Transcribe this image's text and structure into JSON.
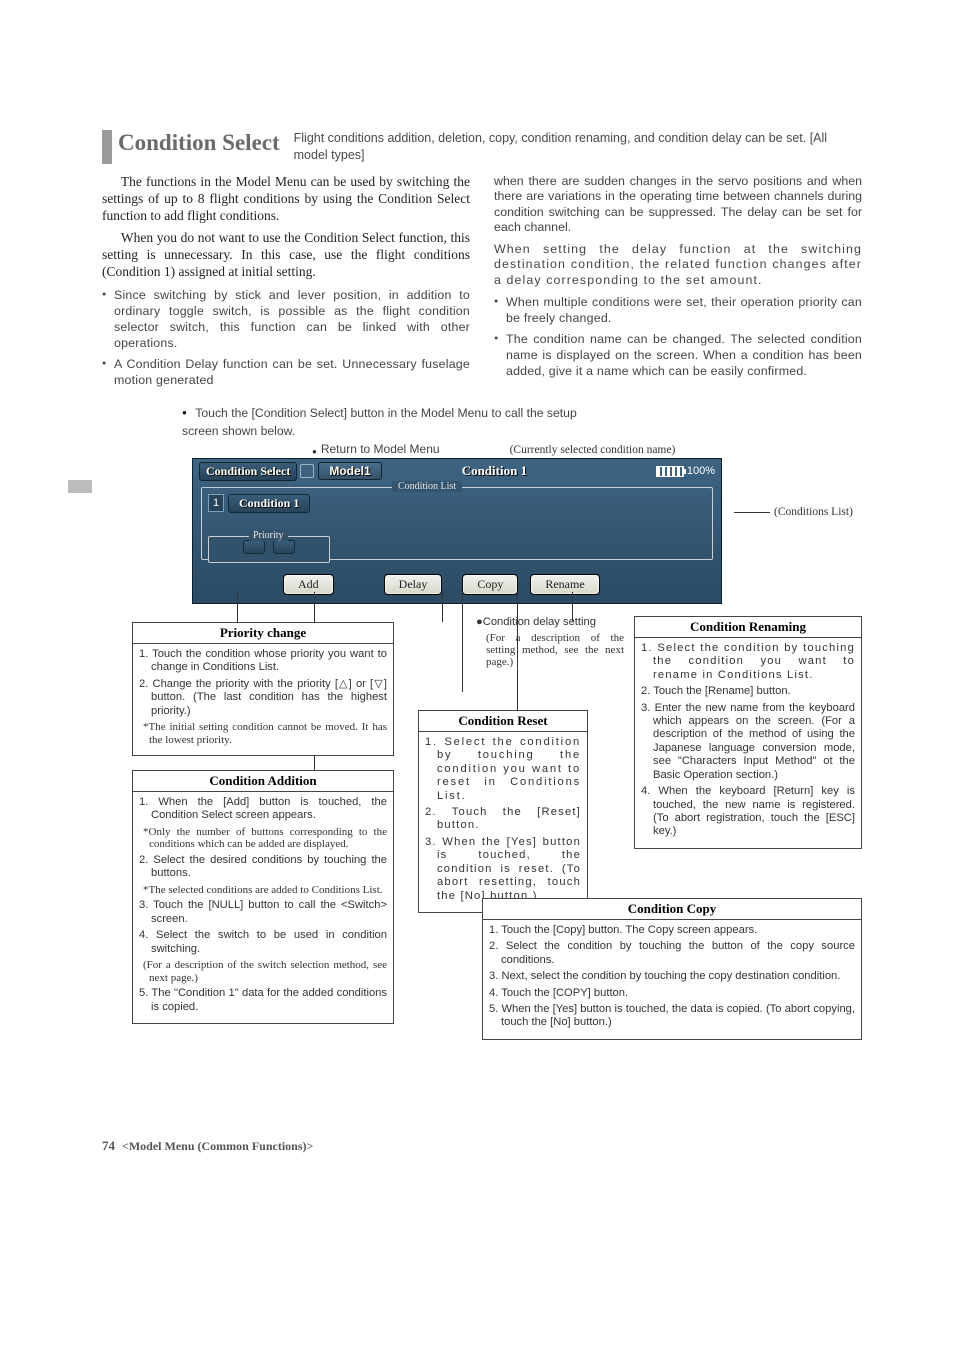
{
  "header": {
    "title": "Condition Select",
    "subtitle": "Flight conditions addition, deletion, copy, condition renaming, and condition delay can be set. [All model types]"
  },
  "intro": {
    "p1": "The functions in the Model Menu can be used by switching the settings of up to 8 flight conditions by using the Condition Select function to add flight conditions.",
    "p2": "When you do not want to use the Condition Select function, this setting is unnecessary. In this case, use the flight conditions (Condition 1) assigned at initial setting."
  },
  "left_bullets": [
    "Since switching by stick and lever position, in addition to ordinary toggle switch, is possible as the flight condition selector switch, this function can be linked with other operations.",
    "A Condition Delay function can be set. Unnecessary fuselage motion generated"
  ],
  "right_continuation": "when there are sudden changes in the servo positions and when there are variations in the operating time between channels during condition switching can be suppressed. The delay can be set for each channel.",
  "right_continuation2": "When setting the delay function at the switching destination condition, the related function changes after a delay corresponding to the set amount.",
  "right_bullets": [
    "When multiple conditions were set, their operation priority can be freely changed.",
    "The condition name can be changed. The selected condition name is displayed on the screen. When a condition has been added, give it a name which can be easily confirmed."
  ],
  "touch_note": "Touch the [Condition Select] button in the Model Menu to call the setup screen shown below.",
  "callouts": {
    "return": "Return to Model Menu",
    "current": "(Currently selected condition name)",
    "conditions_list": "(Conditions List)"
  },
  "screen": {
    "title_btn": "Condition Select",
    "model": "Model1",
    "current_condition": "Condition 1",
    "battery": "100%",
    "list_label": "Condition List",
    "row_num": "1",
    "row_name": "Condition 1",
    "priority_label": "Priority",
    "btn_add": "Add",
    "btn_delay": "Delay",
    "btn_copy": "Copy",
    "btn_rename": "Rename"
  },
  "delay_note": {
    "head": "●Condition delay setting",
    "sub": "(For a description of the setting method, see the next page.)"
  },
  "box_priority": {
    "title": "Priority change",
    "items": [
      "1. Touch the condition whose priority you want to change in Conditions List.",
      "2. Change the priority with the priority [△] or [▽] button. (The last condition has the highest priority.)"
    ],
    "note": "*The initial setting condition cannot be moved. It has the lowest priority."
  },
  "box_addition": {
    "title": "Condition Addition",
    "items": [
      "1. When the [Add] button is touched, the Condition Select screen appears.",
      "__note1",
      "2. Select the desired conditions by touching the buttons.",
      "__note2",
      "3. Touch the [NULL] button to call the <Switch> screen.",
      "4. Select the switch to be used in condition switching.",
      "__note3",
      "5. The \"Condition 1\" data for the added conditions is copied."
    ],
    "note1": "*Only the number of buttons corresponding to the conditions which can be added are displayed.",
    "note2": "*The selected conditions are added to Conditions List.",
    "note3": "(For a description of the switch selection method, see next page.)"
  },
  "box_reset": {
    "title": "Condition Reset",
    "items": [
      "1. Select the condition by touching the condition you want to reset in Conditions List.",
      "2. Touch the [Reset] button.",
      "3. When the [Yes] button is touched, the condition is reset. (To abort resetting, touch the [No] button.)"
    ]
  },
  "box_rename": {
    "title": "Condition Renaming",
    "items": [
      "1. Select the condition by touching the condition you want to rename in Conditions List.",
      "2. Touch the [Rename] button.",
      "3. Enter the new name from the keyboard which appears on the screen. (For a description of the method of using the Japanese language conversion mode, see \"Characters Input Method\" ot the Basic Operation section.)",
      "4. When the keyboard [Return] key is touched, the new name is registered. (To abort registration, touch the [ESC] key.)"
    ]
  },
  "box_copy": {
    "title": "Condition Copy",
    "items": [
      "1. Touch the [Copy] button. The Copy screen appears.",
      "2. Select the condition by touching the button of the copy source conditions.",
      "3. Next, select the condition by touching the copy destination condition.",
      "4. Touch the [COPY] button.",
      "5. When the [Yes] button is touched, the data is copied. (To abort copying, touch the [No] button.)"
    ]
  },
  "footer": {
    "page": "74",
    "section": "<Model Menu (Common Functions)>"
  }
}
